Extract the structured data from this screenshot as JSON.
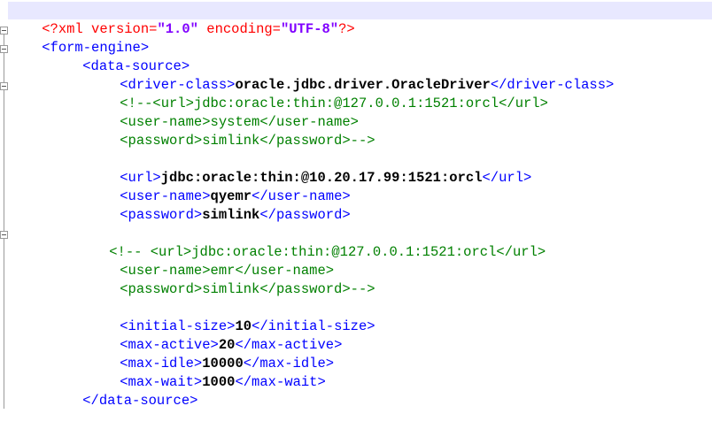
{
  "xml_decl": {
    "open": "<?xml",
    "version_attr": " version=",
    "version_val": "\"1.0\"",
    "encoding_attr": " encoding=",
    "encoding_val": "\"UTF-8\"",
    "close": "?>"
  },
  "lines": {
    "form_engine_open": "<form-engine>",
    "data_source_open": "<data-source>",
    "driver_open": "<driver-class>",
    "driver_val": "oracle.jdbc.driver.OracleDriver",
    "driver_close": "</driver-class>",
    "comment1_a": "<!--<url>jdbc:oracle:thin:@127.0.0.1:1521:orcl</url>",
    "comment1_b": "<user-name>system</user-name>",
    "comment1_c": "<password>simlink</password>-->",
    "url_open": "<url>",
    "url_val": "jdbc:oracle:thin:@10.20.17.99:1521:orcl",
    "url_close": "</url>",
    "user_open": "<user-name>",
    "user_val": "qyemr",
    "user_close": "</user-name>",
    "pass_open": "<password>",
    "pass_val": "simlink",
    "pass_close": "</password>",
    "comment2_a": "<!-- <url>jdbc:oracle:thin:@127.0.0.1:1521:orcl</url>",
    "comment2_b": "<user-name>emr</user-name>",
    "comment2_c": "<password>simlink</password>-->",
    "init_open": "<initial-size>",
    "init_val": "10",
    "init_close": "</initial-size>",
    "maxactive_open": "<max-active>",
    "maxactive_val": "20",
    "maxactive_close": "</max-active>",
    "maxidle_open": "<max-idle>",
    "maxidle_val": "10000",
    "maxidle_close": "</max-idle>",
    "maxwait_open": "<max-wait>",
    "maxwait_val": "1000",
    "maxwait_close": "</max-wait>",
    "data_source_close": "</data-source>"
  }
}
